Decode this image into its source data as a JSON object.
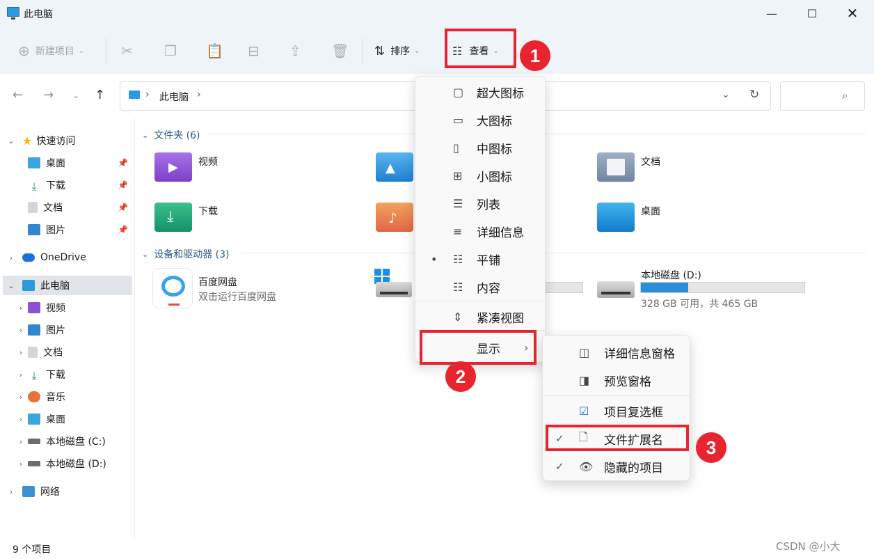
{
  "window": {
    "title": "此电脑"
  },
  "toolbar": {
    "new_label": "新建项目",
    "sort_label": "排序",
    "view_label": "查看"
  },
  "address": {
    "location": "此电脑"
  },
  "nav": {
    "quick_access": "快速访问",
    "quick_items": [
      "桌面",
      "下载",
      "文档",
      "图片"
    ],
    "onedrive": "OneDrive",
    "this_pc": "此电脑",
    "pc_items": [
      "视频",
      "图片",
      "文档",
      "下载",
      "音乐",
      "桌面",
      "本地磁盘 (C:)",
      "本地磁盘 (D:)"
    ],
    "network": "网络"
  },
  "content": {
    "folders_header": "文件夹 (6)",
    "folders": [
      "视频",
      "文档",
      "下载",
      "桌面"
    ],
    "devices_header": "设备和驱动器 (3)",
    "baidu_name": "百度网盘",
    "baidu_sub": "双击运行百度网盘",
    "d_drive_name": "本地磁盘 (D:)",
    "d_drive_info": "328 GB 可用，共 465 GB",
    "d_drive_used_fraction": 0.29
  },
  "view_menu": {
    "items": [
      "超大图标",
      "大图标",
      "中图标",
      "小图标",
      "列表",
      "详细信息",
      "平铺",
      "内容",
      "紧凑视图"
    ],
    "selected": "平铺",
    "show_label": "显示"
  },
  "show_menu": {
    "items": [
      "详细信息窗格",
      "预览窗格",
      "项目复选框",
      "文件扩展名",
      "隐藏的项目"
    ],
    "checked": [
      "文件扩展名",
      "隐藏的项目"
    ]
  },
  "annotations": {
    "b1": "1",
    "b2": "2",
    "b3": "3"
  },
  "status": {
    "count": "9 个项目"
  },
  "watermark": "CSDN @小大"
}
